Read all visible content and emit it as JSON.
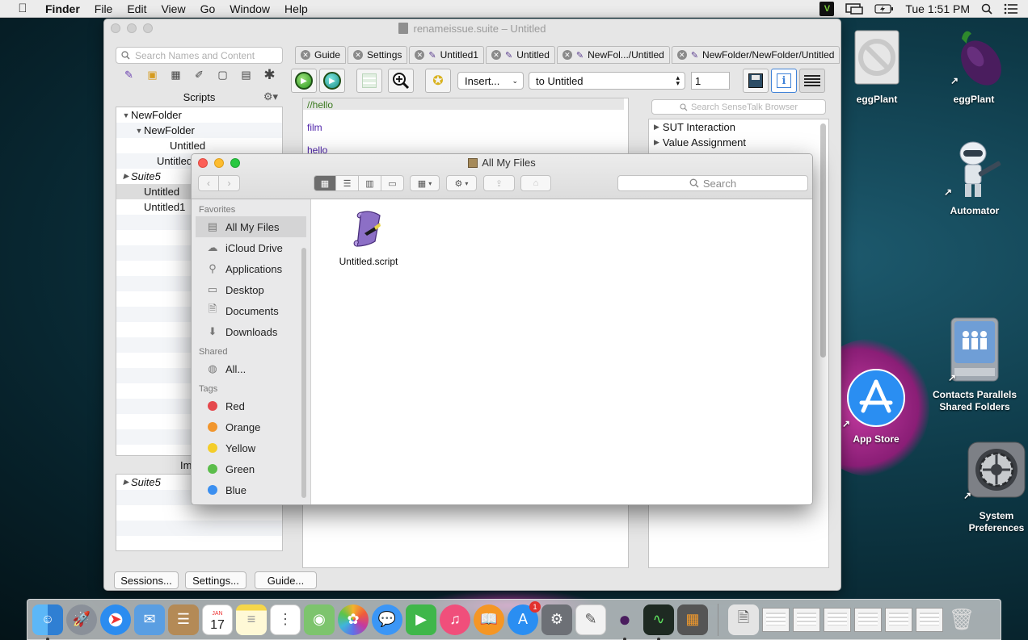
{
  "menubar": {
    "app": "Finder",
    "items": [
      "File",
      "Edit",
      "View",
      "Go",
      "Window",
      "Help"
    ],
    "vc_label": "V",
    "clock": "Tue 1:51 PM"
  },
  "main_window": {
    "title": "renameissue.suite – Untitled",
    "search_placeholder": "Search Names and Content",
    "scripts_header": "Scripts",
    "tree": [
      {
        "label": "NewFolder",
        "indent": 0,
        "tri": "▼",
        "italic": false
      },
      {
        "label": "NewFolder",
        "indent": 1,
        "tri": "▼",
        "italic": false
      },
      {
        "label": "Untitled",
        "indent": 3,
        "tri": "",
        "italic": false
      },
      {
        "label": "Untitled",
        "indent": 2,
        "tri": "",
        "italic": false
      },
      {
        "label": "Suite5",
        "indent": 0,
        "tri": "▶",
        "italic": true
      },
      {
        "label": "Untitled",
        "indent": 1,
        "tri": "",
        "italic": false,
        "selected": true
      },
      {
        "label": "Untitled1",
        "indent": 1,
        "tri": "",
        "italic": false
      }
    ],
    "lower_label": "Im",
    "lower_tree": [
      {
        "label": "Suite5",
        "tri": "▶",
        "italic": true
      }
    ],
    "tabs": [
      {
        "label": "Guide",
        "script": false
      },
      {
        "label": "Settings",
        "script": false
      },
      {
        "label": "Untitled1",
        "script": true
      },
      {
        "label": "Untitled",
        "script": true
      },
      {
        "label": "NewFol.../Untitled",
        "script": true
      },
      {
        "label": "NewFolder/NewFolder/Untitled",
        "script": true
      }
    ],
    "insert_select": "Insert...",
    "target_select": "to Untitled",
    "count_value": "1",
    "editor_lines": [
      "//hello",
      "film",
      "hello"
    ],
    "browser_search_placeholder": "Search SenseTalk Browser",
    "browser_items": [
      "SUT Interaction",
      "Value Assignment"
    ],
    "bottom_buttons": [
      "Sessions...",
      "Settings...",
      "Guide..."
    ]
  },
  "finder": {
    "title": "All My Files",
    "search_placeholder": "Search",
    "favorites_header": "Favorites",
    "favorites": [
      {
        "label": "All My Files",
        "icon": "all-files-icon",
        "glyph": "▤",
        "selected": true
      },
      {
        "label": "iCloud Drive",
        "icon": "cloud-icon",
        "glyph": "☁"
      },
      {
        "label": "Applications",
        "icon": "applications-icon",
        "glyph": "⚲"
      },
      {
        "label": "Desktop",
        "icon": "desktop-icon",
        "glyph": "▭"
      },
      {
        "label": "Documents",
        "icon": "documents-icon",
        "glyph": "🗎"
      },
      {
        "label": "Downloads",
        "icon": "downloads-icon",
        "glyph": "⬇"
      }
    ],
    "shared_header": "Shared",
    "shared": [
      {
        "label": "All...",
        "icon": "network-icon",
        "glyph": "◍"
      }
    ],
    "tags_header": "Tags",
    "tags": [
      {
        "label": "Red",
        "color": "#e5484d"
      },
      {
        "label": "Orange",
        "color": "#f1962e"
      },
      {
        "label": "Yellow",
        "color": "#f4cd2a"
      },
      {
        "label": "Green",
        "color": "#5bbd4b"
      },
      {
        "label": "Blue",
        "color": "#3b8ff0"
      }
    ],
    "files": [
      {
        "label": "Untitled.script"
      }
    ]
  },
  "desktop": {
    "icons": [
      {
        "label": "eggPlant"
      },
      {
        "label": "eggPlant"
      },
      {
        "label": "Automator"
      },
      {
        "label": "Contacts Parallels Shared Folders"
      },
      {
        "label": "App Store"
      },
      {
        "label": "System Preferences"
      }
    ]
  },
  "dock": {
    "appstore_badge": "1",
    "calendar_month": "JAN",
    "calendar_day": "17"
  }
}
